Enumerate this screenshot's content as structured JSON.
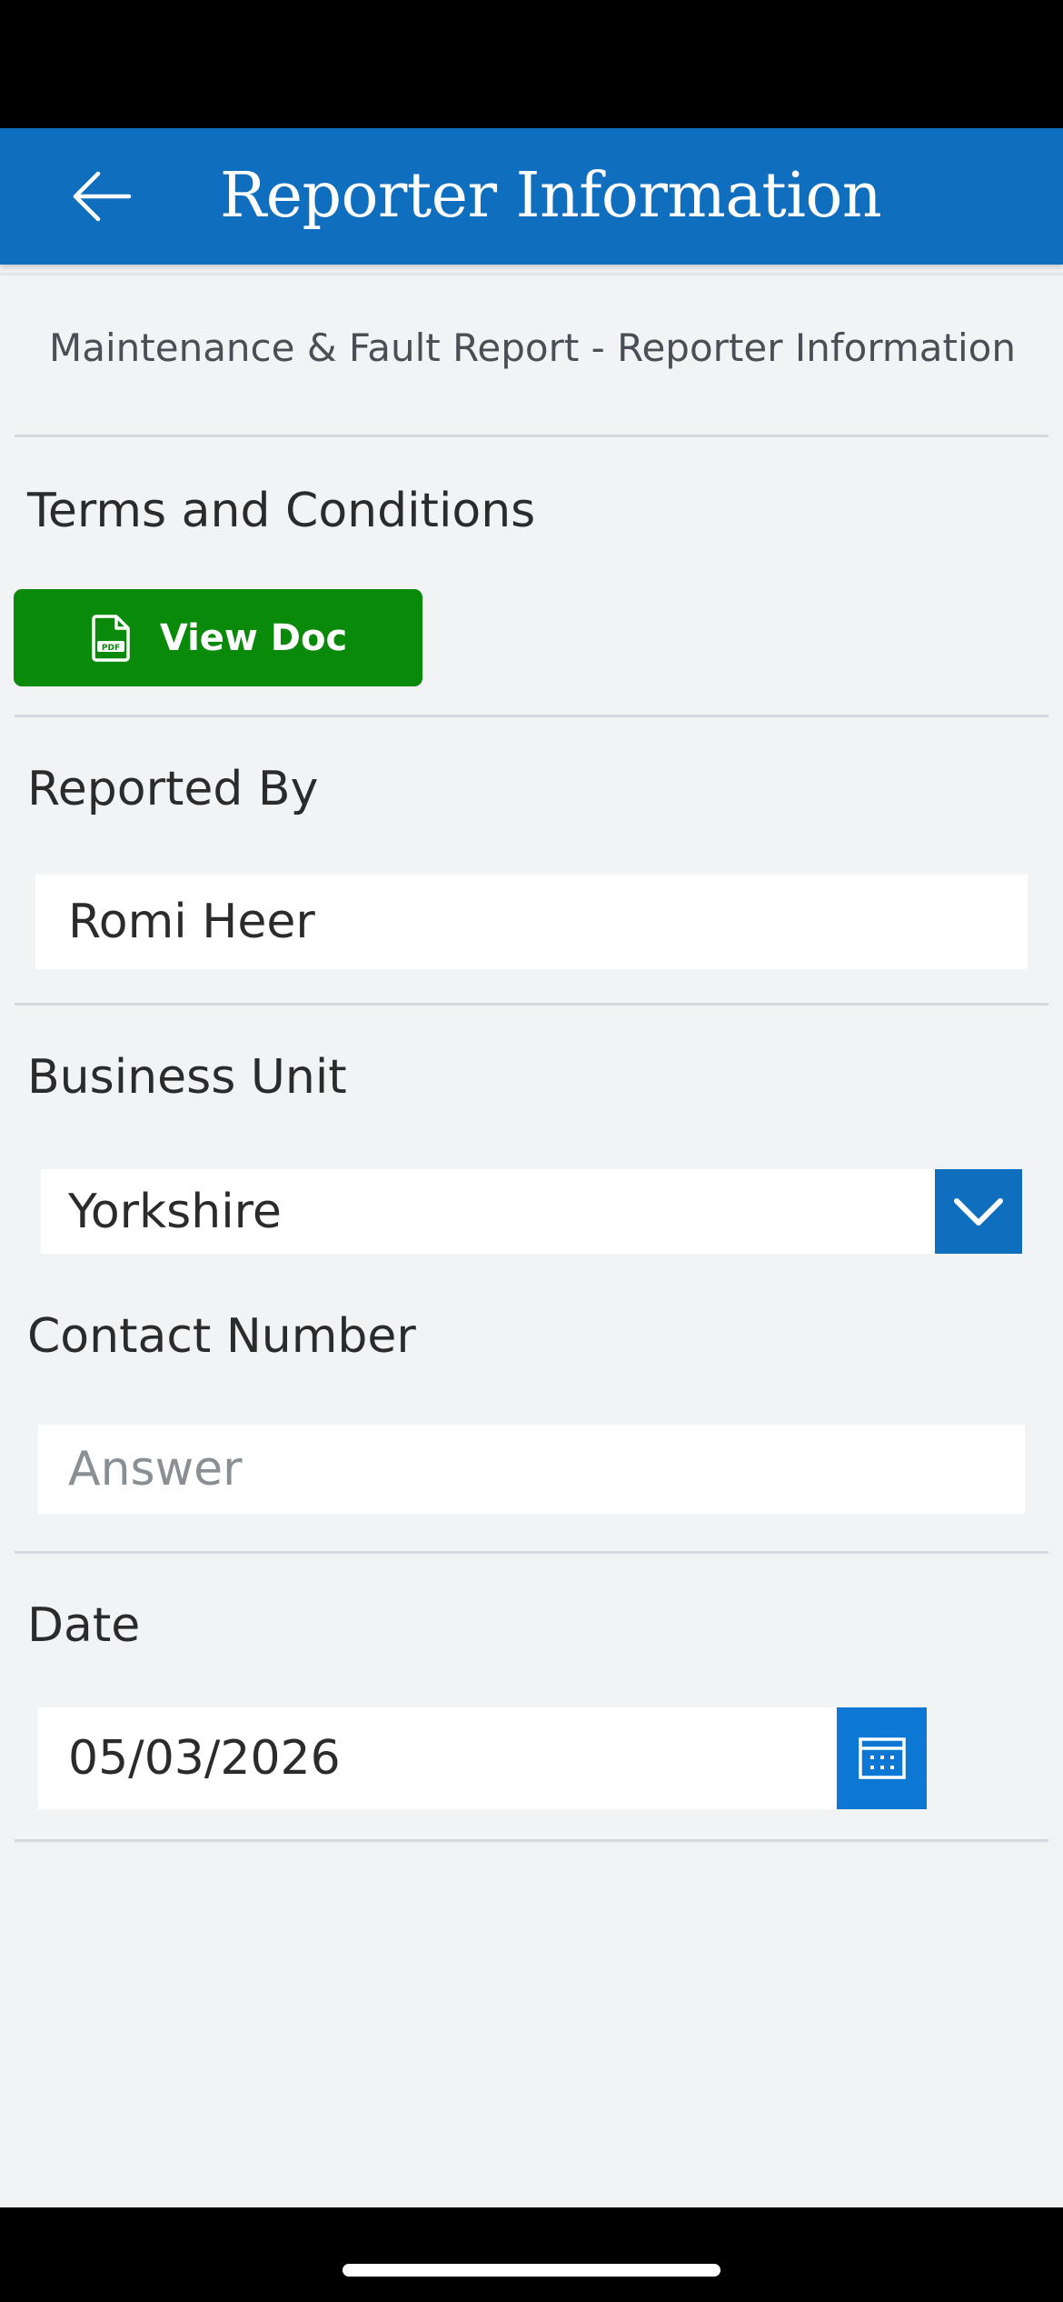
{
  "header": {
    "title": "Reporter Information",
    "back_icon": "arrow-left-icon",
    "background_color": "#106ebe"
  },
  "form": {
    "subtitle": "Maintenance & Fault Report - Reporter Information",
    "terms": {
      "label": "Terms and Conditions",
      "button_label": "View Doc",
      "button_icon": "pdf-file-icon",
      "button_color": "#0a8a0a"
    },
    "reported_by": {
      "label": "Reported By",
      "value": "Romi Heer"
    },
    "business_unit": {
      "label": "Business Unit",
      "selected": "Yorkshire",
      "chevron_icon": "chevron-down-icon"
    },
    "contact_number": {
      "label": "Contact Number",
      "placeholder": "Answer",
      "value": ""
    },
    "date": {
      "label": "Date",
      "value": "05/03/2026",
      "calendar_icon": "calendar-icon"
    }
  }
}
